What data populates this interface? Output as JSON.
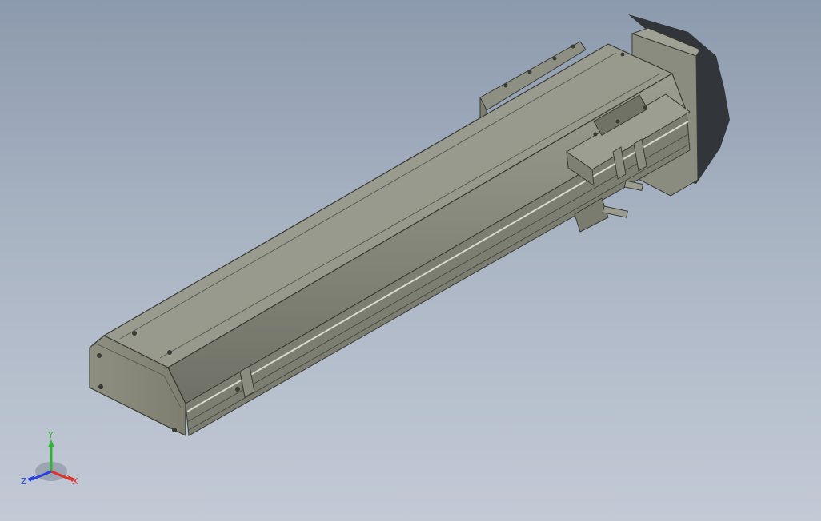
{
  "viewport": {
    "background_top": "#8c9aad",
    "background_bottom": "#c3cad6"
  },
  "model": {
    "body_color": "#8f9184",
    "top_color": "#9a9c8f",
    "end_cap_color": "#8a8b7b",
    "edge_color": "#3a3a34",
    "shadow_color": "#2c2f33"
  },
  "triad": {
    "x_label": "X",
    "y_label": "Y",
    "z_label": "Z",
    "x_color": "#e0302a",
    "y_color": "#2fb52f",
    "z_color": "#2a3fe0"
  }
}
